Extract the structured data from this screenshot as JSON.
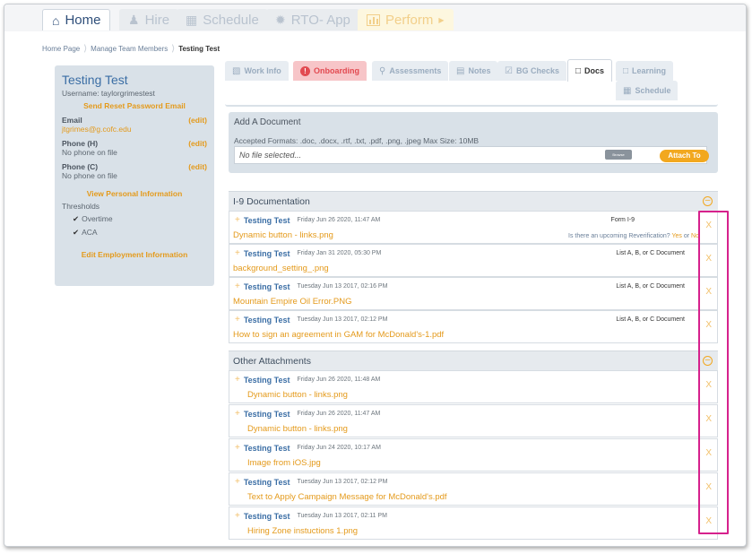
{
  "nav": {
    "tabs": [
      {
        "label": "Home",
        "icon": "home-icon"
      },
      {
        "label": "Hire",
        "icon": "users-icon"
      },
      {
        "label": "Schedule",
        "icon": "calendar-icon"
      },
      {
        "label": "RTO- App",
        "icon": "gear-icon"
      },
      {
        "label": "Perform",
        "icon": "bar-chart-icon"
      }
    ]
  },
  "breadcrumb": {
    "items": [
      "Home Page",
      "Manage Team Members",
      "Testing Test"
    ]
  },
  "sidebar": {
    "name": "Testing Test",
    "username": "Username: taylorgrimestest",
    "send_reset": "Send Reset Password Email",
    "email_label": "Email",
    "email_value": "jtgrimes@g.cofc.edu",
    "phone_h_label": "Phone (H)",
    "phone_h_value": "No phone on file",
    "phone_c_label": "Phone (C)",
    "phone_c_value": "No phone on file",
    "edit_label": "(edit)",
    "view_personal": "View Personal Information",
    "thresholds_label": "Thresholds",
    "thresholds": [
      "Overtime",
      "ACA"
    ],
    "edit_employment": "Edit Employment Information"
  },
  "tabs": {
    "work_info": "Work Info",
    "onboarding": "Onboarding",
    "assessments": "Assessments",
    "notes": "Notes",
    "bg_checks": "BG Checks",
    "docs": "Docs",
    "learning": "Learning",
    "schedule": "Schedule"
  },
  "add_document": {
    "title": "Add A Document",
    "formats": "Accepted Formats: .doc, .docx, .rtf, .txt, .pdf, .png, .jpeg Max Size: 10MB",
    "file_placeholder": "No file selected...",
    "browse_label": "Browse",
    "attach_label": "Attach To"
  },
  "i9": {
    "title": "I-9 Documentation",
    "reverification_question": "Is there an upcoming Reverification?",
    "yes_label": "Yes",
    "or_label": "or",
    "no_label": "No",
    "rows": [
      {
        "name": "Testing Test",
        "date": "Friday Jun 26 2020, 11:47 AM",
        "type": "Form I-9",
        "file": "Dynamic button - links.png"
      },
      {
        "name": "Testing Test",
        "date": "Friday Jan 31 2020, 05:30 PM",
        "type": "List A, B, or C Document",
        "file": "background_setting_.png"
      },
      {
        "name": "Testing Test",
        "date": "Tuesday Jun 13 2017, 02:16 PM",
        "type": "List A, B, or C Document",
        "file": "Mountain Empire Oil Error.PNG"
      },
      {
        "name": "Testing Test",
        "date": "Tuesday Jun 13 2017, 02:12 PM",
        "type": "List A, B, or C Document",
        "file": "How to sign an agreement in GAM for McDonald's-1.pdf"
      }
    ]
  },
  "other": {
    "title": "Other Attachments",
    "rows": [
      {
        "name": "Testing Test",
        "date": "Friday Jun 26 2020, 11:48 AM",
        "file": "Dynamic button - links.png"
      },
      {
        "name": "Testing Test",
        "date": "Friday Jun 26 2020, 11:47 AM",
        "file": "Dynamic button - links.png"
      },
      {
        "name": "Testing Test",
        "date": "Friday Jun 24 2020, 10:17 AM",
        "file": "Image from iOS.jpg"
      },
      {
        "name": "Testing Test",
        "date": "Tuesday Jun 13 2017, 02:12 PM",
        "file": "Text to Apply Campaign Message for McDonald's.pdf"
      },
      {
        "name": "Testing Test",
        "date": "Tuesday Jun 13 2017, 02:11 PM",
        "file": "Hiring Zone instuctions 1.png"
      }
    ]
  },
  "delete_glyph": "X",
  "colors": {
    "accent_orange": "#e49a1b",
    "name_blue": "#3b6ea5",
    "onboarding_red": "#e24a51",
    "highlight_magenta": "#d6218c"
  }
}
